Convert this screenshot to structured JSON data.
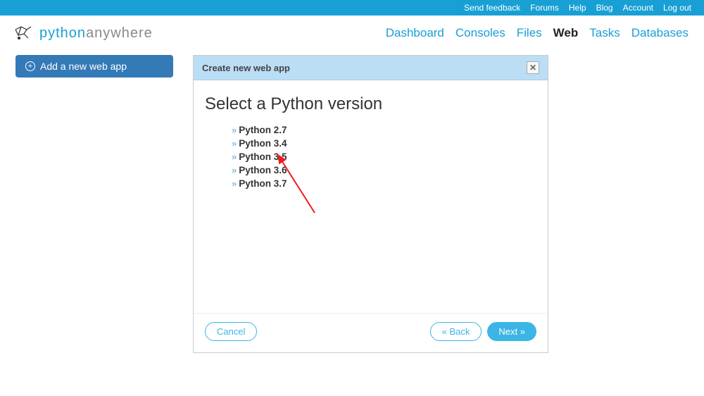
{
  "topbar": {
    "links": [
      "Send feedback",
      "Forums",
      "Help",
      "Blog",
      "Account",
      "Log out"
    ]
  },
  "logo": {
    "part1": "python",
    "part2": "anywhere"
  },
  "nav": {
    "items": [
      "Dashboard",
      "Consoles",
      "Files",
      "Web",
      "Tasks",
      "Databases"
    ],
    "active_index": 3
  },
  "sidebar": {
    "add_button": "Add a new web app"
  },
  "modal": {
    "header": "Create new web app",
    "title": "Select a Python version",
    "versions": [
      "Python 2.7",
      "Python 3.4",
      "Python 3.5",
      "Python 3.6",
      "Python 3.7"
    ],
    "cancel": "Cancel",
    "back": "« Back",
    "next": "Next »"
  }
}
